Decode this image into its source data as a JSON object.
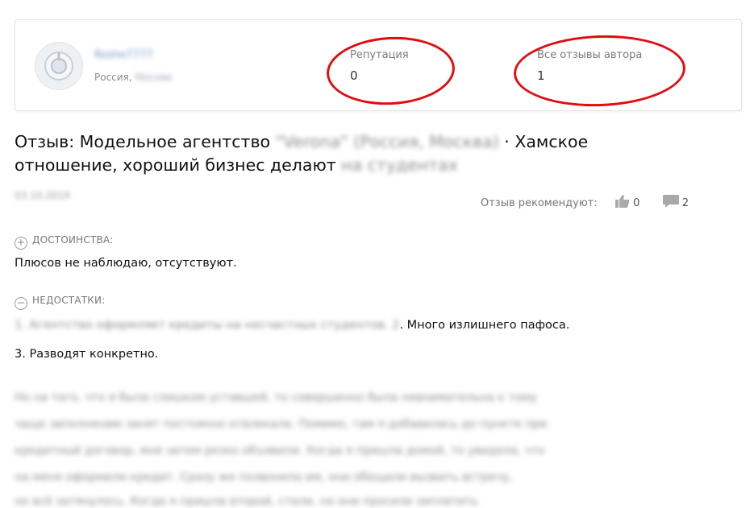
{
  "author": {
    "username": "Roshe7777",
    "country": "Россия,",
    "city": "Москва"
  },
  "stats": {
    "reputation_label": "Репутация",
    "reputation_value": "0",
    "reviews_label": "Все отзывы автора",
    "reviews_value": "1"
  },
  "review": {
    "title_prefix": "Отзыв: Модельное агентство",
    "agency_blurred": "\"Veronа\" (Россия, Москва)",
    "title_mid": "· Хамское",
    "title_line2": "отношение, хороший бизнес делают",
    "title_blurred2": "на студентах",
    "date": "03.10.2019",
    "recommend_label": "Отзыв рекомендуют:",
    "likes": "0",
    "comments": "2"
  },
  "pros": {
    "label": "ДОСТОИНСТВА:",
    "text": "Плюсов не наблюдаю, отсутствуют."
  },
  "cons": {
    "label": "НЕДОСТАТКИ:",
    "blurred": "1. Агентство оформляет кредиты на несчастных студентов. 2",
    "text_end": ". Много излишнего пафоса.",
    "text2": "3. Разводят конкретно."
  },
  "body_blurred": [
    "Но на того, что я была слишком уставшей, то совершенно была невнимательна к тому",
    "чаще заполнению занят постоянно отвлекала. Помимо, там я добавилась до пунктe при",
    "кредитный договор, мне затем резко объявили. Когда я пришла домой, то увидела, что",
    "на меня оформили кредит. Сразу же позвонила им, они обещали вызвать встречу,",
    "но всё затянулось. Когда я пришла второй, стали, но они просили заплатить"
  ],
  "icons": {
    "like": "thumbs-up-icon",
    "comment": "comment-icon",
    "plus": "plus-circle-icon",
    "minus": "minus-circle-icon"
  },
  "colors": {
    "annotation": "#e10d10",
    "link": "#6f95c2"
  }
}
